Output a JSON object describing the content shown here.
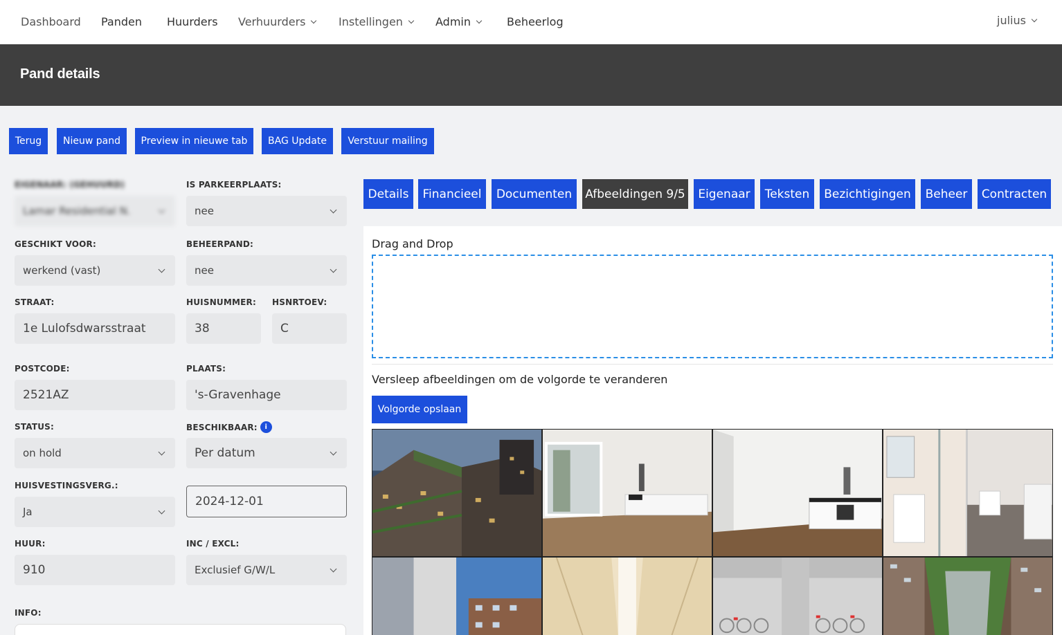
{
  "nav": {
    "dashboard": "Dashboard",
    "panden": "Panden",
    "huurders": "Huurders",
    "verhuurders": "Verhuurders",
    "instellingen": "Instellingen",
    "admin": "Admin",
    "beheerlog": "Beheerlog",
    "user": "julius"
  },
  "header": {
    "title": "Pand details"
  },
  "actions": {
    "terug": "Terug",
    "nieuw_pand": "Nieuw pand",
    "preview": "Preview in nieuwe tab",
    "bag_update": "BAG Update",
    "verstuur_mailing": "Verstuur mailing"
  },
  "form": {
    "eigenaar_label": "EIGENAAR: (GEHUURD)",
    "eigenaar_value": "Lamar Residential N.",
    "parkeerplaats_label": "IS PARKEERPLAATS:",
    "parkeerplaats_value": "nee",
    "geschikt_label": "GESCHIKT VOOR:",
    "geschikt_value": "werkend (vast)",
    "beheerpand_label": "BEHEERPAND:",
    "beheerpand_value": "nee",
    "straat_label": "STRAAT:",
    "straat_value": "1e Lulofsdwarsstraat",
    "huisnummer_label": "HUISNUMMER:",
    "huisnummer_value": "38",
    "hsnrtoev_label": "HSNRTOEV:",
    "hsnrtoev_value": "C",
    "postcode_label": "POSTCODE:",
    "postcode_value": "2521AZ",
    "plaats_label": "PLAATS:",
    "plaats_value": "'s-Gravenhage",
    "status_label": "STATUS:",
    "status_value": "on hold",
    "beschikbaar_label": "BESCHIKBAAR:",
    "beschikbaar_info": "i",
    "beschikbaar_value": "Per datum",
    "huisvesting_label": "HUISVESTINGSVERG.:",
    "huisvesting_value": "Ja",
    "datum_value": "2024-12-01",
    "huur_label": "HUUR:",
    "huur_value": "910",
    "incexcl_label": "INC / EXCL:",
    "incexcl_value": "Exclusief G/W/L",
    "info_label": "INFO:"
  },
  "tabs": {
    "details": "Details",
    "financieel": "Financieel",
    "documenten": "Documenten",
    "afbeeldingen": "Afbeeldingen 9/5",
    "eigenaar": "Eigenaar",
    "teksten": "Teksten",
    "bezichtigingen": "Bezichtigingen",
    "beheer": "Beheer",
    "contracten": "Contracten"
  },
  "images_panel": {
    "drag_title": "Drag and Drop",
    "reorder_hint": "Versleep afbeeldingen om de volgorde te veranderen",
    "save_order": "Volgorde opslaan"
  },
  "colors": {
    "primary": "#1c4fdc",
    "header_bg": "#3f3f3f",
    "page_bg": "#f1f2f4",
    "dropzone_border": "#2a8ee6"
  }
}
